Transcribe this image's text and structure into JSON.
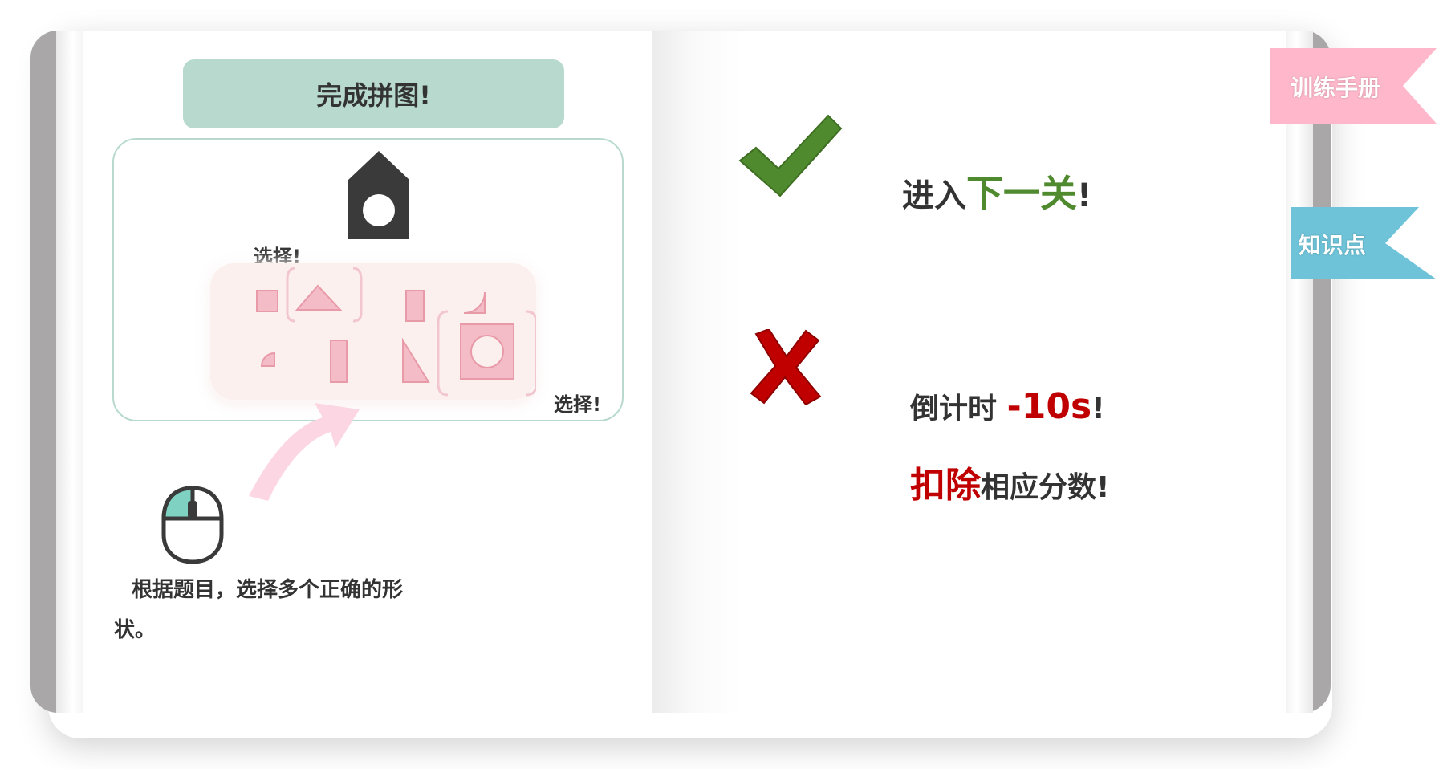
{
  "left_page": {
    "title": "完成拼图!",
    "choose_label_1": "选择!",
    "choose_label_2": "选择!",
    "instruction": "根据题目，选择多个正确的形状。"
  },
  "right_page": {
    "correct": {
      "prefix": "进入",
      "highlight": "下一关",
      "suffix": "!"
    },
    "wrong_1": {
      "prefix": "倒计时 ",
      "highlight": "-10s",
      "suffix": "!"
    },
    "wrong_2": {
      "highlight": "扣除",
      "suffix": "相应分数!"
    }
  },
  "tabs": {
    "manual": "训练手册",
    "knowledge": "知识点"
  },
  "colors": {
    "title_bar": "#b8dace",
    "correct_green": "#4f8a2e",
    "wrong_red": "#c00000",
    "tab_manual": "#ffb8cb",
    "tab_knowledge": "#6ec3d8",
    "shape_pink": "#f4bcc6"
  },
  "icons": [
    "house-icon",
    "mouse-icon",
    "arrow-icon",
    "check-icon",
    "cross-icon"
  ]
}
